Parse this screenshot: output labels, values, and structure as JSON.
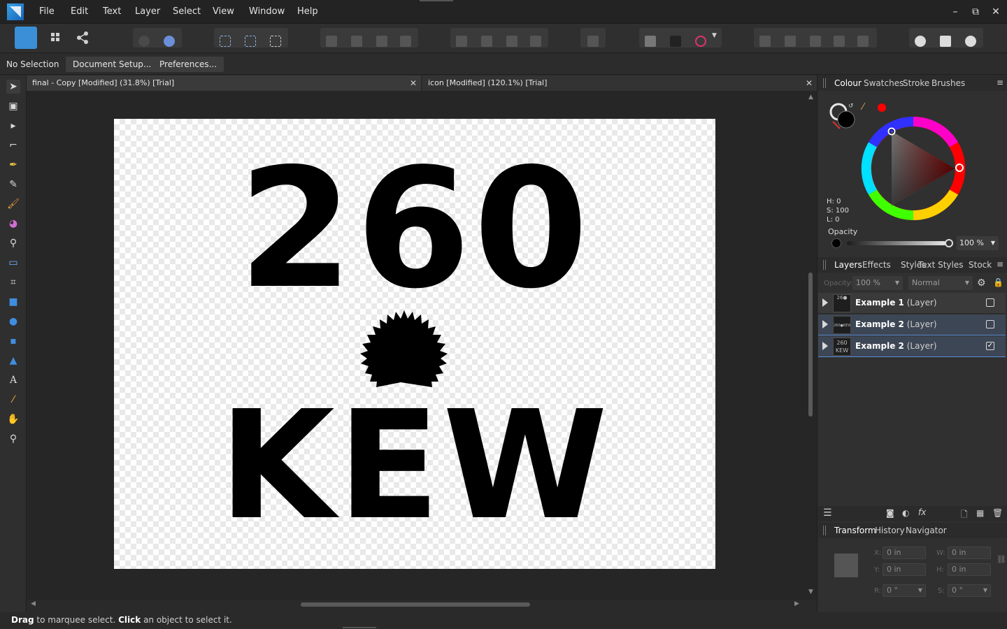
{
  "menu": [
    "File",
    "Edit",
    "Text",
    "Layer",
    "Select",
    "View",
    "Window",
    "Help"
  ],
  "window_controls": {
    "minimize": "–",
    "restore": "⧉",
    "close": "✕"
  },
  "context_bar": {
    "selection": "No Selection",
    "document_setup": "Document Setup...",
    "preferences": "Preferences..."
  },
  "tabs": [
    {
      "title": "final - Copy [Modified] (31.8%) [Trial]",
      "close": "✕"
    },
    {
      "title": "icon [Modified] (120.1%) [Trial]",
      "close": "✕"
    }
  ],
  "artwork": {
    "top_text": "260",
    "bottom_text": "KEW"
  },
  "status": {
    "drag": "Drag",
    "drag_text": " to marquee select. ",
    "click": "Click",
    "click_text": " an object to select it."
  },
  "colour_panel": {
    "tabs": [
      "Colour",
      "Swatches",
      "Stroke",
      "Brushes"
    ],
    "h": "H: 0",
    "s": "S: 100",
    "l": "L: 0",
    "opacity_label": "Opacity",
    "opacity_value": "100 %",
    "fill_color": "#000000",
    "accent_color": "#ff0000"
  },
  "layers_panel": {
    "tabs": [
      "Layers",
      "Effects",
      "Styles",
      "Text Styles",
      "Stock"
    ],
    "opacity_label": "Opacity:",
    "opacity_value": "100 %",
    "blend_mode": "Normal",
    "layers": [
      {
        "name": "Example 1",
        "kind": "(Layer)",
        "thumb": "26●",
        "visible": false
      },
      {
        "name": "Example 2",
        "kind": "(Layer)",
        "thumb": "260●KEW",
        "visible": false
      },
      {
        "name": "Example 2",
        "kind": "(Layer)",
        "thumb": "260\nKEW",
        "visible": true
      }
    ]
  },
  "transform_panel": {
    "tabs": [
      "Transform",
      "History",
      "Navigator"
    ],
    "x_label": "X:",
    "x_value": "0 in",
    "y_label": "Y:",
    "y_value": "0 in",
    "w_label": "W:",
    "w_value": "0 in",
    "h_label": "H:",
    "h_value": "0 in",
    "r_label": "R:",
    "r_value": "0 °",
    "s_label": "S:",
    "s_value": "0 °"
  }
}
